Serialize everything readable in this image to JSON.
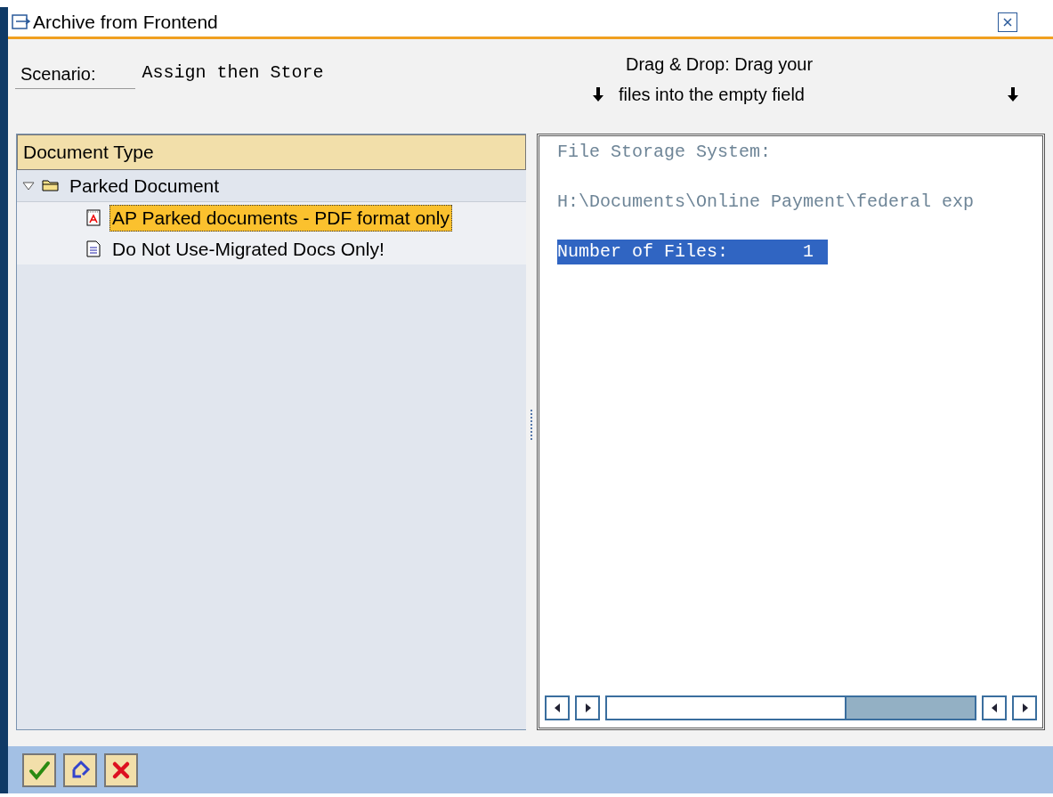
{
  "window": {
    "title": "Archive from Frontend"
  },
  "scenario": {
    "label": "Scenario:",
    "value": "Assign then Store"
  },
  "drag_hint": {
    "line_1": "Drag & Drop: Drag your",
    "line_2": "files into the empty field"
  },
  "tree": {
    "header": "Document Type",
    "items": [
      {
        "label": "Parked Document",
        "kind": "folder",
        "expanded": true,
        "selected": false,
        "children": [
          {
            "label": "AP Parked documents - PDF format only",
            "kind": "pdf",
            "selected": true
          },
          {
            "label": "Do Not Use-Migrated Docs Only!",
            "kind": "document",
            "selected": false
          }
        ]
      }
    ]
  },
  "drop_area": {
    "lines": [
      {
        "text": "File Storage System:",
        "selected": false
      },
      {
        "text": "H:\\Documents\\Online Payment\\federal exp",
        "selected": false
      },
      {
        "text": "Number of Files:       1",
        "selected": true
      }
    ]
  },
  "toolbar": {
    "buttons": [
      {
        "kind": "confirm"
      },
      {
        "kind": "reset"
      },
      {
        "kind": "cancel"
      }
    ]
  }
}
